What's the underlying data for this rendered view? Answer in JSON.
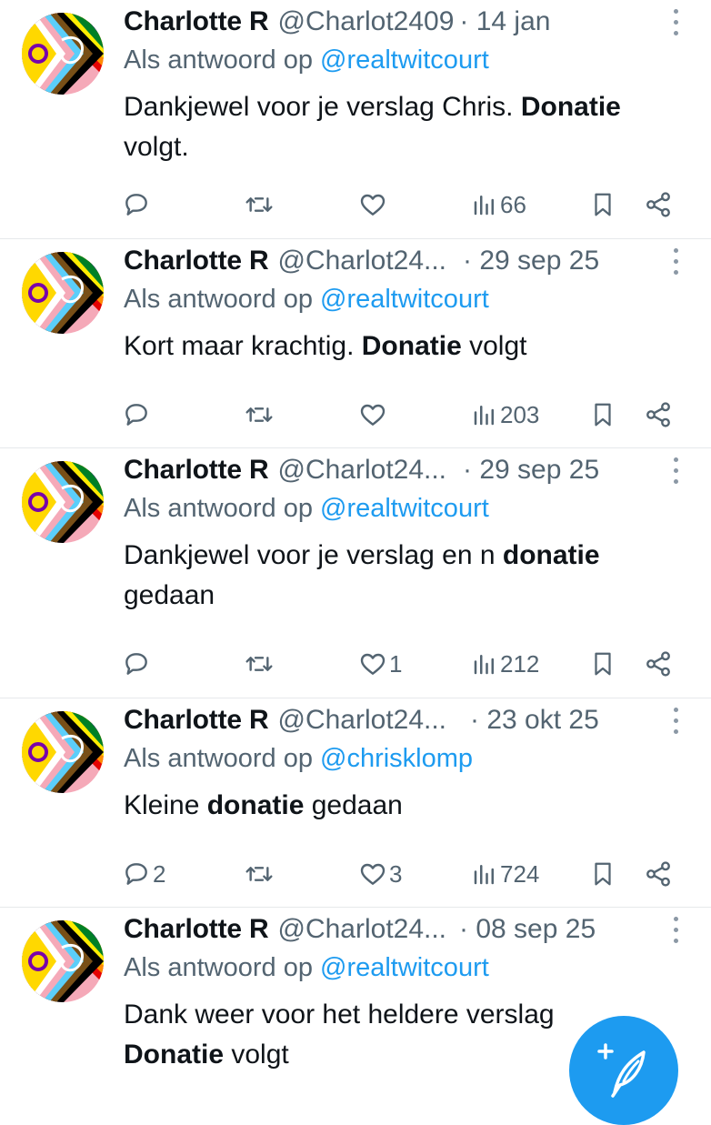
{
  "tweets": [
    {
      "name": "Charlotte R",
      "handle": "@Charlot2409",
      "date": "· 14 jan",
      "reply_prefix": "Als antwoord op ",
      "reply_to": "@realtwitcourt",
      "body": [
        {
          "text": "Dankjewel voor je verslag Chris. ",
          "bold": false
        },
        {
          "text": "Donatie",
          "bold": true
        },
        {
          "text": " volgt.",
          "bold": false
        }
      ],
      "replies": "",
      "retweets": "",
      "likes": "",
      "views": "66"
    },
    {
      "name": "Charlotte R",
      "handle": "@Charlot24...",
      "date": "· 29 sep 25",
      "reply_prefix": "Als antwoord op ",
      "reply_to": "@realtwitcourt",
      "body": [
        {
          "text": "Kort maar krachtig. ",
          "bold": false
        },
        {
          "text": "Donatie",
          "bold": true
        },
        {
          "text": " volgt",
          "bold": false
        }
      ],
      "replies": "",
      "retweets": "",
      "likes": "",
      "views": "203"
    },
    {
      "name": "Charlotte R",
      "handle": "@Charlot24...",
      "date": "· 29 sep 25",
      "reply_prefix": "Als antwoord op ",
      "reply_to": "@realtwitcourt",
      "body": [
        {
          "text": "Dankjewel voor je verslag en n ",
          "bold": false
        },
        {
          "text": "donatie",
          "bold": true
        },
        {
          "text": " gedaan",
          "bold": false
        }
      ],
      "replies": "",
      "retweets": "",
      "likes": "1",
      "views": "212"
    },
    {
      "name": "Charlotte R",
      "handle": "@Charlot24...",
      "date": "· 23 okt 25",
      "reply_prefix": "Als antwoord op ",
      "reply_to": "@chrisklomp",
      "body": [
        {
          "text": "Kleine ",
          "bold": false
        },
        {
          "text": "donatie",
          "bold": true
        },
        {
          "text": " gedaan",
          "bold": false
        }
      ],
      "replies": "2",
      "retweets": "",
      "likes": "3",
      "views": "724"
    },
    {
      "name": "Charlotte R",
      "handle": "@Charlot24...",
      "date": "· 08 sep 25",
      "reply_prefix": "Als antwoord op ",
      "reply_to": "@realtwitcourt",
      "body": [
        {
          "text": "Dank weer voor het heldere verslag",
          "bold": false
        },
        {
          "text": " ",
          "bold": false
        },
        {
          "text": "Donatie",
          "bold": true
        },
        {
          "text": " volgt",
          "bold": false
        }
      ],
      "replies": "",
      "retweets": "",
      "likes": "",
      "views": ""
    }
  ],
  "icons": {
    "avatar": "progress-pride-flag-avatar",
    "reply": "speech-bubble-icon",
    "retweet": "retweet-icon",
    "like": "heart-icon",
    "views": "bar-chart-icon",
    "bookmark": "bookmark-icon",
    "share": "share-icon",
    "more": "more-vertical-icon",
    "compose": "feather-plus-icon"
  },
  "colors": {
    "link": "#1d9bf0",
    "secondary_text": "#536471",
    "primary_text": "#0f1419",
    "fab": "#1d9bf0"
  }
}
